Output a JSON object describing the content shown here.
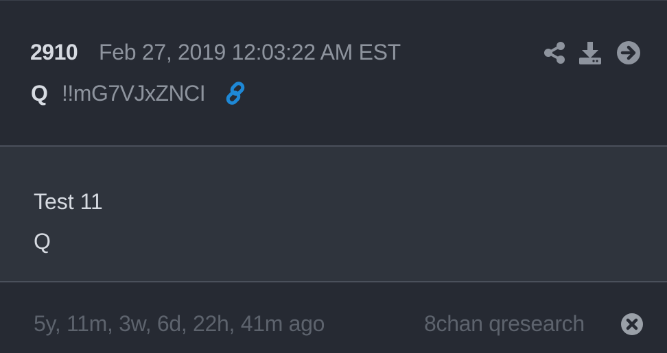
{
  "post": {
    "number": "2910",
    "date": "Feb 27, 2019 12:03:22 AM EST",
    "author": "Q",
    "tripcode": "!!mG7VJxZNCI",
    "body_lines": [
      "Test 11",
      "Q"
    ],
    "ago": "5y, 11m, 3w, 6d, 22h, 41m ago",
    "source": "8chan qresearch"
  },
  "icons": {
    "link": "link-icon",
    "share": "share-icon",
    "download": "download-icon",
    "goto": "arrow-right-circle-icon",
    "close": "close-circle-icon"
  },
  "colors": {
    "link_accent": "#1e88d6",
    "icon_gray": "#8e949e",
    "close_gray": "#9aa0a8"
  }
}
